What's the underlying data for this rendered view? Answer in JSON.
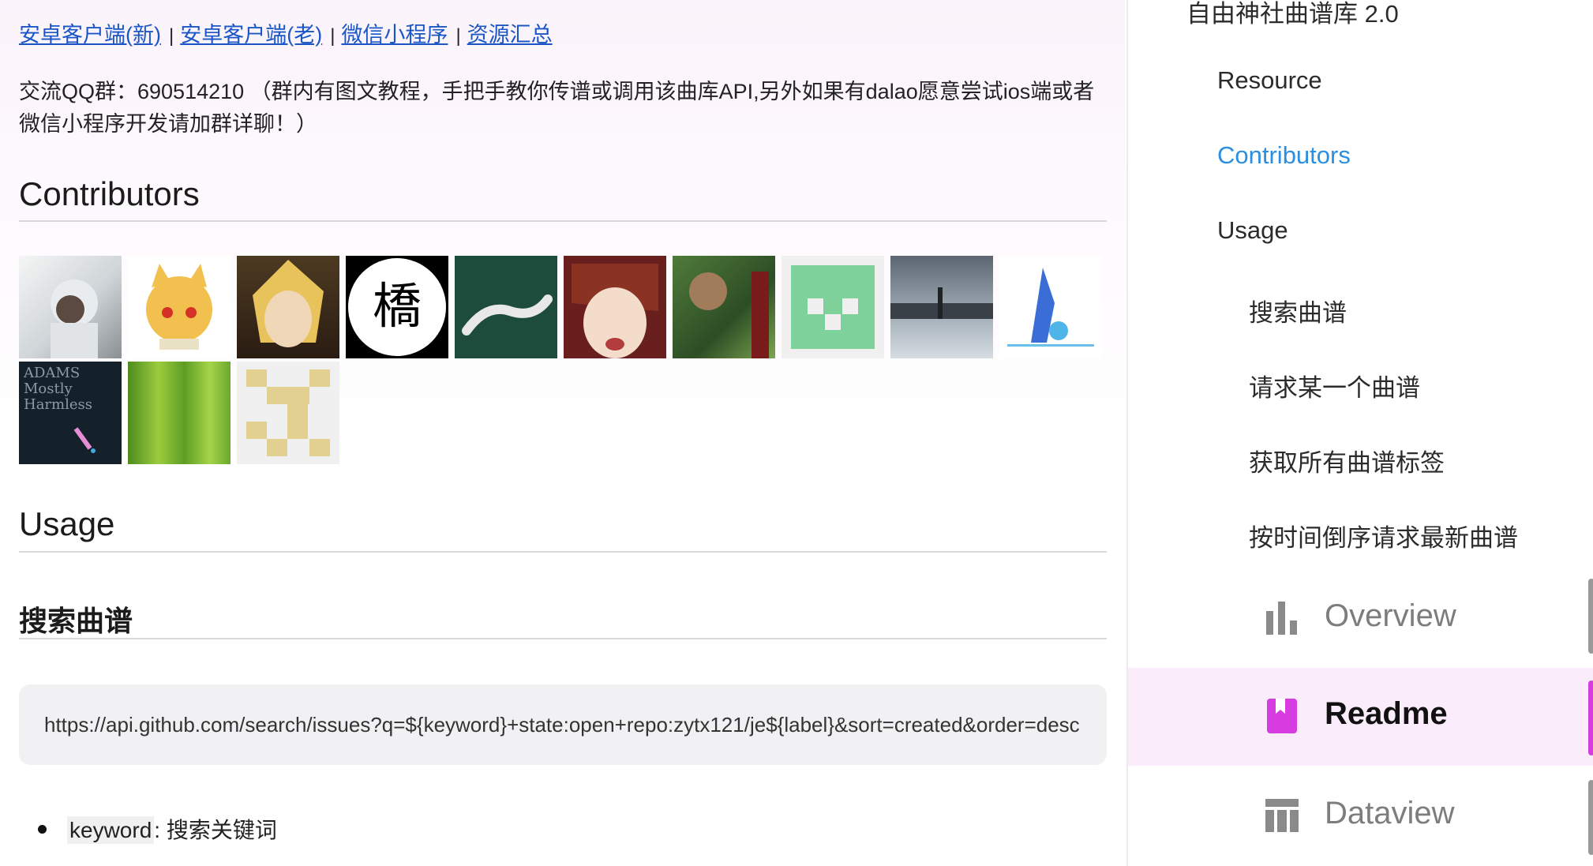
{
  "links": [
    {
      "label": "安卓客户端(新)"
    },
    {
      "label": "安卓客户端(老)"
    },
    {
      "label": "微信小程序"
    },
    {
      "label": "资源汇总"
    }
  ],
  "qq_text": "交流QQ群：690514210 （群内有图文教程，手把手教你传谱或调用该曲库API,另外如果有dalao愿意尝试ios端或者微信小程序开发请加群详聊！）",
  "contributors": {
    "heading": "Contributors"
  },
  "usage": {
    "heading": "Usage",
    "search_heading": "搜索曲谱",
    "code": "https://api.github.com/search/issues?q=${keyword}+state:open+repo:zytx121/je${label}&sort=created&order=desc",
    "param_key": "keyword",
    "param_desc": ": 搜索关键词"
  },
  "toc": {
    "title": "自由神社曲谱库 2.0",
    "items": [
      {
        "label": "Resource"
      },
      {
        "label": "Contributors"
      },
      {
        "label": "Usage"
      },
      {
        "label": "搜索曲谱"
      },
      {
        "label": "请求某一个曲谱"
      },
      {
        "label": "获取所有曲谱标签"
      },
      {
        "label": "按时间倒序请求最新曲谱"
      }
    ]
  },
  "nav": {
    "overview": "Overview",
    "readme": "Readme",
    "dataview": "Dataview"
  },
  "colors": {
    "link": "#1a56c5",
    "active_toc": "#2b8ee0",
    "active_nav_bg": "#fbecfb",
    "accent": "#d63ce0"
  }
}
